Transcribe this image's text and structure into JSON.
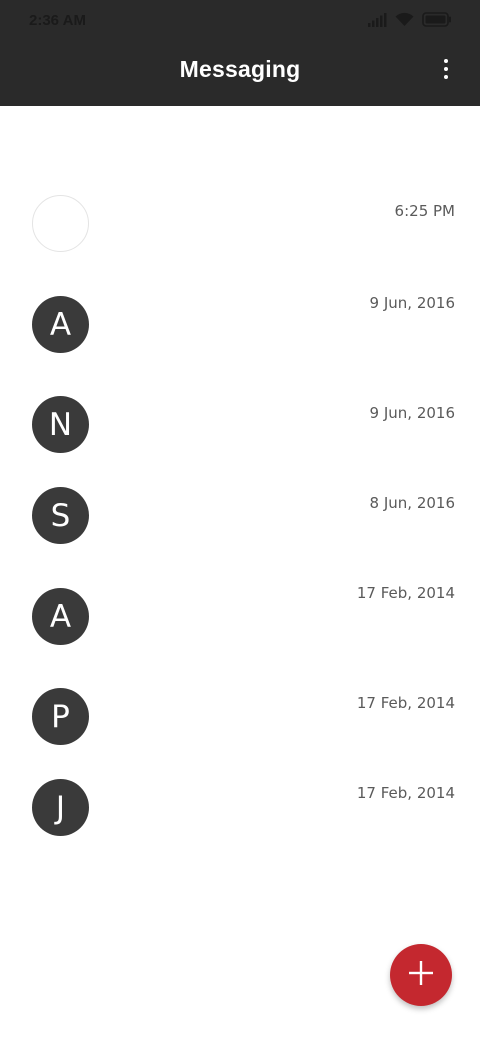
{
  "status_bar": {
    "time": "2:36 AM",
    "icons": [
      "signal-icon",
      "wifi-icon",
      "battery-icon"
    ]
  },
  "app_bar": {
    "title": "Messaging",
    "menu_icon": "more-vert-icon",
    "background": "#2a2a2a"
  },
  "conversations": [
    {
      "initial": "",
      "date": "6:25 PM"
    },
    {
      "initial": "A",
      "date": "9 Jun, 2016"
    },
    {
      "initial": "N",
      "date": "9 Jun, 2016"
    },
    {
      "initial": "S",
      "date": "8 Jun, 2016"
    },
    {
      "initial": "A",
      "date": "17 Feb, 2014"
    },
    {
      "initial": "P",
      "date": "17 Feb, 2014"
    },
    {
      "initial": "J",
      "date": "17 Feb, 2014"
    }
  ],
  "fab": {
    "icon": "plus-icon",
    "color": "#c4282f"
  }
}
